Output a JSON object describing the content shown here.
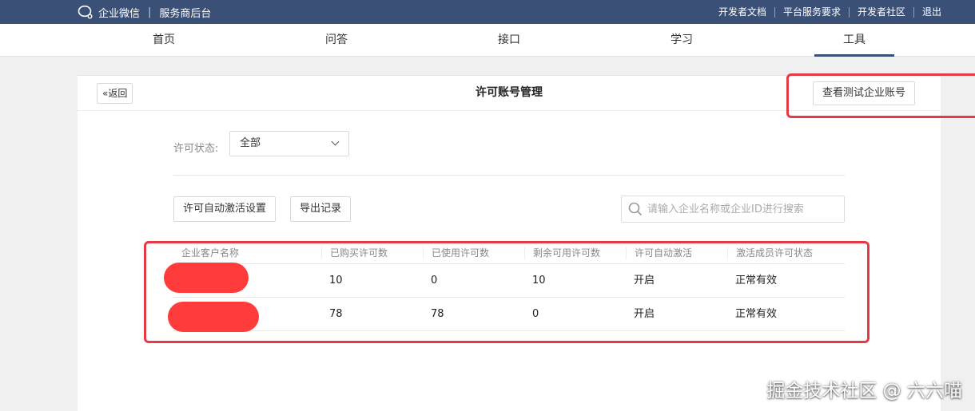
{
  "topbar": {
    "brand": "企业微信",
    "subtitle": "服务商后台",
    "links": [
      "开发者文档",
      "平台服务要求",
      "开发者社区",
      "退出"
    ]
  },
  "nav": {
    "items": [
      "首页",
      "问答",
      "接口",
      "学习",
      "工具"
    ],
    "active": "工具"
  },
  "page": {
    "back_label": "返回",
    "title": "许可账号管理",
    "test_button": "查看测试企业账号"
  },
  "filter": {
    "label": "许可状态:",
    "selected": "全部"
  },
  "actions": {
    "auto_activate": "许可自动激活设置",
    "export": "导出记录"
  },
  "search": {
    "placeholder": "请输入企业名称或企业ID进行搜索"
  },
  "table": {
    "columns": [
      "企业客户名称",
      "已购买许可数",
      "已使用许可数",
      "剩余可用许可数",
      "许可自动激活",
      "激活成员许可状态"
    ],
    "rows": [
      {
        "purchased": "10",
        "used": "0",
        "remaining": "10",
        "auto": "开启",
        "status": "正常有效"
      },
      {
        "purchased": "78",
        "used": "78",
        "remaining": "0",
        "auto": "开启",
        "status": "正常有效"
      }
    ]
  },
  "colors": {
    "topbar": "#3a5077",
    "highlight": "#e63946",
    "redaction": "#ff3b3b"
  },
  "watermark": "掘金技术社区 @ 六六喵"
}
